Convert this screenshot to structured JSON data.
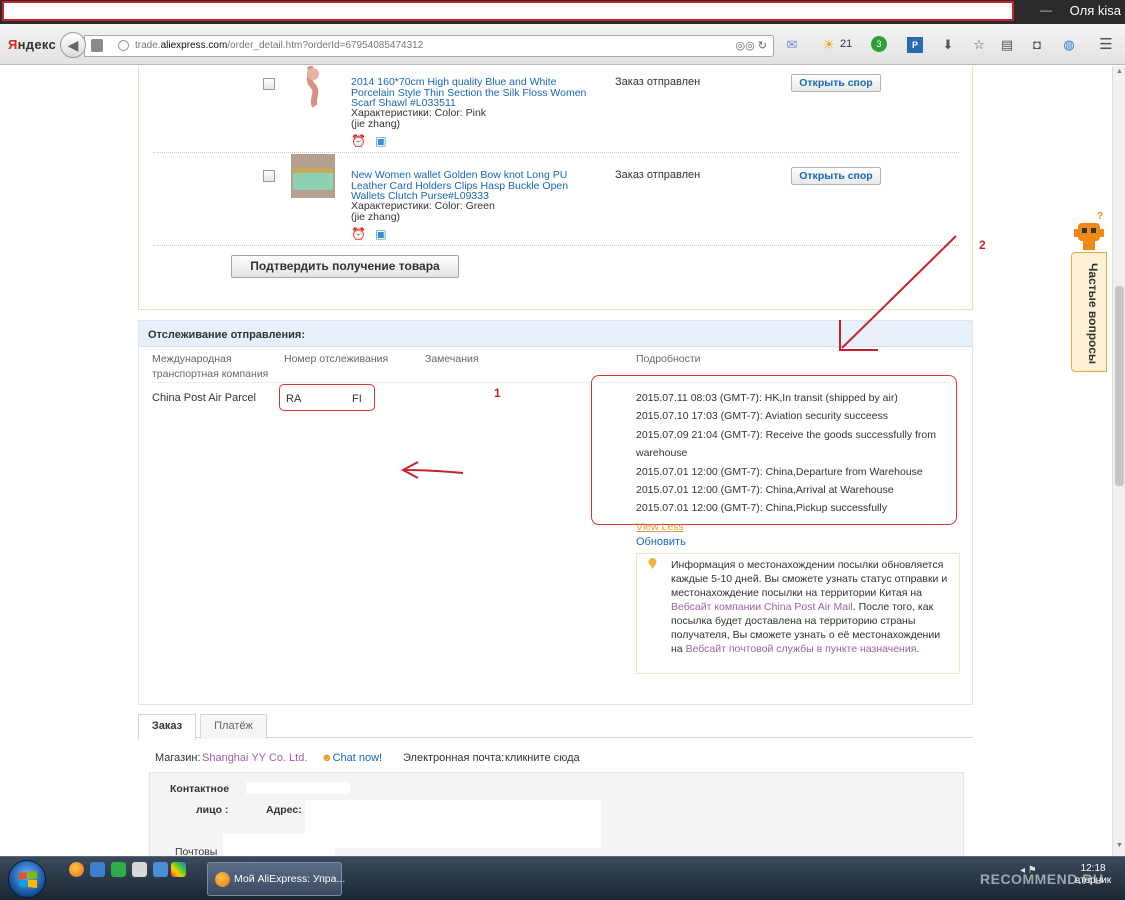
{
  "titlebar": {
    "user": "Оля kisa"
  },
  "browser": {
    "brand_y": "Я",
    "brand_rest": "ндекс",
    "url_prefix": "trade.",
    "url_domain": "aliexpress.com",
    "url_path": "/order_detail.htm?orderId=67954085474312",
    "weather": "21",
    "badge_count": "3"
  },
  "products": [
    {
      "title": "2014 160*70cm High quality Blue and White Porcelain Style Thin Section the Silk Floss Women Scarf Shawl #L033511",
      "attr": "Характеристики: Color: Pink",
      "seller": "(jie zhang)",
      "status": "Заказ отправлен",
      "dispute": "Открыть спор"
    },
    {
      "title": "New Women wallet Golden Bow knot Long PU Leather Card Holders Clips Hasp Buckle Open Wallets Clutch Purse#L09333",
      "attr": "Характеристики: Color: Green",
      "seller": "(jie zhang)",
      "status": "Заказ отправлен",
      "dispute": "Открыть спор"
    }
  ],
  "confirm_button": "Подтвердить получение товара",
  "tracking": {
    "title": "Отслеживание отправления:",
    "col_carrier_1": "Международная",
    "col_carrier_2": "транспортная компания",
    "col_number": "Номер отслеживания",
    "col_notes": "Замечания",
    "col_details": "Подробности",
    "carrier": "China Post Air Parcel",
    "number_start": "RA",
    "number_end": "FI",
    "events": [
      "2015.07.11 08:03 (GMT-7): HK,In transit (shipped by air)",
      "2015.07.10 17:03 (GMT-7): Aviation security succeess",
      "2015.07.09 21:04 (GMT-7): Receive the goods successfully from",
      "warehouse",
      "2015.07.01 12:00 (GMT-7): China,Departure from Warehouse",
      "2015.07.01 12:00 (GMT-7): China,Arrival at Warehouse",
      "2015.07.01 12:00 (GMT-7): China,Pickup successfully"
    ],
    "view_less": "View Less",
    "refresh": "Обновить",
    "info_1": "Информация о местонахождении посылки обновляется каждые 5-10 дней. Вы сможете узнать статус отправки и местонахождение посылки на территории Китая на ",
    "info_link_1": "Вебсайт компании China Post Air Mail",
    "info_2": ". После того, как посылка будет доставлена на территорию страны получателя, Вы сможете узнать о её местонахождении на ",
    "info_link_2": "Вебсайт почтовой службы в пункте назначения",
    "info_3": "."
  },
  "tabs": [
    {
      "label": "Заказ"
    },
    {
      "label": "Платёж"
    }
  ],
  "shop": {
    "label": "Магазин:",
    "name": "Shanghai YY Co. Ltd.",
    "chat": "Chat now!",
    "email_label": "Электронная почта:",
    "email_link": "кликните сюда"
  },
  "contact": {
    "contact_1": "Контактное",
    "contact_2": "лицо :",
    "address": "Адрес:",
    "postal": "Почтовы"
  },
  "faq": {
    "label": "Частые вопросы"
  },
  "annotations": {
    "one": "1",
    "two": "2"
  },
  "taskbar": {
    "task_label": "Мой AliExpress: Упра...",
    "watermark": "RECOMMEND.RU",
    "clock_time": "12:18",
    "clock_day": "вторник"
  },
  "colors": {
    "accent_red": "#c8232c",
    "link_blue": "#1a66b8",
    "tracking_header_bg": "#e8f0fb"
  }
}
